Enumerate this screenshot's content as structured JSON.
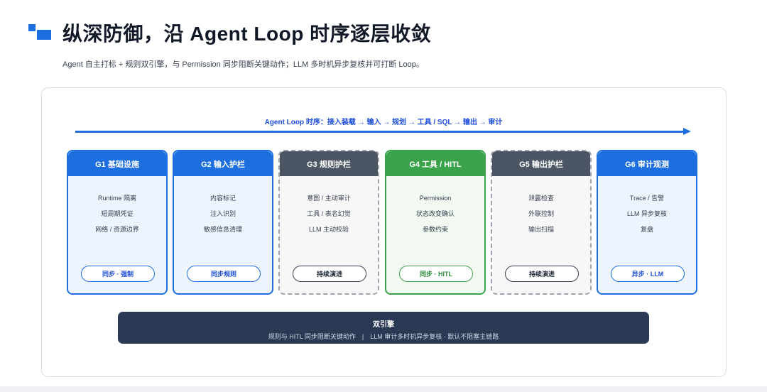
{
  "header": {
    "title": "纵深防御，沿 Agent Loop 时序逐层收敛",
    "subtitle": "Agent 自主打标 + 规则双引擎，与 Permission 同步阻断关键动作；LLM 多时机异步复核并可打断 Loop。"
  },
  "flow": {
    "label": "Agent Loop 时序：接入装载 → 输入 → 规划 → 工具 / SQL → 输出 → 审计"
  },
  "gates": [
    {
      "title": "G1 基础设施",
      "lines": [
        "Runtime 隔离",
        "短周期凭证",
        "网络 / 资源边界"
      ],
      "pill": "同步 · 强制",
      "style": "blue"
    },
    {
      "title": "G2 输入护栏",
      "lines": [
        "内容标记",
        "注入识别",
        "敏感信息清理"
      ],
      "pill": "同步规则",
      "style": "blue"
    },
    {
      "title": "G3 规则护栏",
      "lines": [
        "意图 / 主动审计",
        "工具 / 表名幻觉",
        "LLM 主动校验"
      ],
      "pill": "持续演进",
      "style": "grey"
    },
    {
      "title": "G4 工具 / HITL",
      "lines": [
        "Permission",
        "状态改变确认",
        "参数约束"
      ],
      "pill": "同步 · HITL",
      "style": "green"
    },
    {
      "title": "G5 输出护栏",
      "lines": [
        "泄露检查",
        "外联控制",
        "输出扫描"
      ],
      "pill": "持续演进",
      "style": "grey"
    },
    {
      "title": "G6 审计观测",
      "lines": [
        "Trace / 告警",
        "LLM 异步复核",
        "复盘"
      ],
      "pill": "异步 · LLM",
      "style": "blue"
    }
  ],
  "engine": {
    "title": "双引擎",
    "desc": "规则与 HITL 同步阻断关键动作　|　LLM 审计多时机异步复核 · 默认不阻塞主链路"
  },
  "colors": {
    "blue": "#1d6fe0",
    "green": "#3aa24a",
    "grey": "#4b5563",
    "navy": "#2a3a55"
  }
}
